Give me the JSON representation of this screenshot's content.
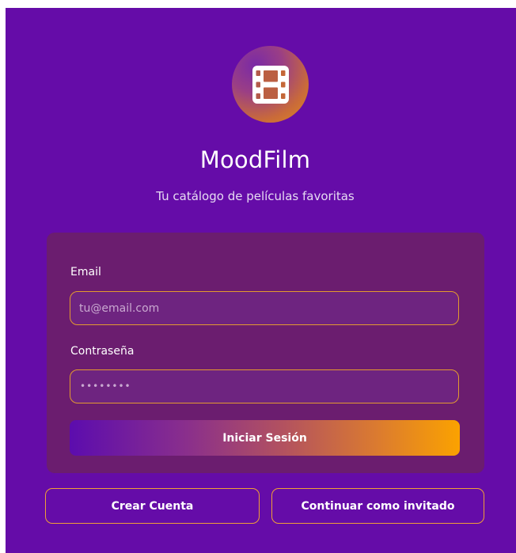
{
  "brand": {
    "logo_icon": "film-icon",
    "title": "MoodFilm",
    "subtitle": "Tu catálogo de películas favoritas"
  },
  "login_form": {
    "email_label": "Email",
    "email_placeholder": "tu@email.com",
    "password_label": "Contraseña",
    "password_value": "••••••••",
    "submit_label": "Iniciar Sesión"
  },
  "actions": {
    "create_account_label": "Crear Cuenta",
    "guest_label": "Continuar como invitado"
  },
  "colors": {
    "background": "#650ca8",
    "card": "#6b1d6f",
    "accent_orange": "#f5a000",
    "accent_purple": "#5c0cae"
  }
}
